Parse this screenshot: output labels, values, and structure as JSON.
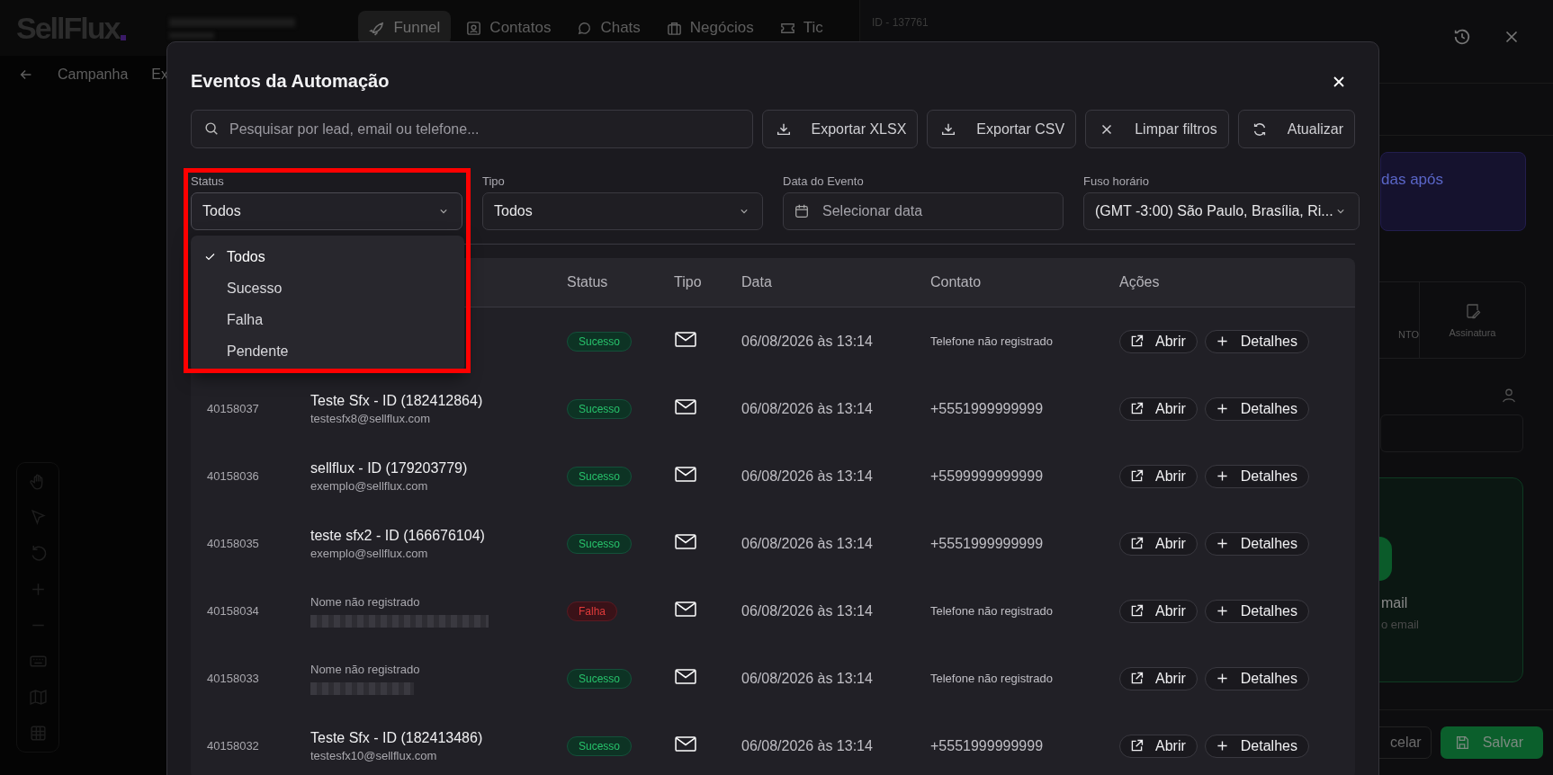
{
  "app": {
    "logo": "SellFlux",
    "nav": [
      {
        "label": "Funnel",
        "selected": true,
        "kind": "rocket"
      },
      {
        "label": "Contatos",
        "selected": false,
        "kind": "contact"
      },
      {
        "label": "Chats",
        "selected": false,
        "kind": "chat"
      },
      {
        "label": "Negócios",
        "selected": false,
        "kind": "briefcase"
      },
      {
        "label": "Tic",
        "selected": false,
        "kind": "ticket"
      }
    ],
    "breadcrumb": [
      "Campanha",
      "Ex"
    ]
  },
  "side_panel": {
    "id_label": "ID - 137761",
    "banner_text": "das após",
    "cards": [
      {
        "label": "NTO",
        "kind": "partial"
      },
      {
        "label": "Assinatura",
        "kind": "signature"
      }
    ],
    "email_card": {
      "title": "mail",
      "subtitle": "o email"
    },
    "buttons": [
      {
        "label": "celar",
        "kind": "secondary"
      },
      {
        "label": "Salvar",
        "kind": "primary"
      }
    ]
  },
  "modal": {
    "title": "Eventos da Automação",
    "search": {
      "placeholder": "Pesquisar por lead, email ou telefone..."
    },
    "actions": [
      {
        "label": "Exportar XLSX",
        "kind": "download"
      },
      {
        "label": "Exportar CSV",
        "kind": "download"
      },
      {
        "label": "Limpar filtros",
        "kind": "clear"
      },
      {
        "label": "Atualizar",
        "kind": "refresh"
      }
    ],
    "filters": [
      {
        "label": "Status",
        "value": "Todos",
        "kind": "select",
        "open": true,
        "highlighted": true
      },
      {
        "label": "Tipo",
        "value": "Todos",
        "kind": "select",
        "open": false
      },
      {
        "label": "Data do Evento",
        "placeholder": "Selecionar data",
        "kind": "date"
      },
      {
        "label": "Fuso horário",
        "value": "(GMT -3:00) São Paulo, Brasília, Ri...",
        "kind": "select",
        "open": false
      }
    ],
    "status_menu": [
      {
        "label": "Todos",
        "selected": true
      },
      {
        "label": "Sucesso",
        "selected": false
      },
      {
        "label": "Falha",
        "selected": false
      },
      {
        "label": "Pendente",
        "selected": false
      }
    ],
    "table": {
      "columns": [
        "Status",
        "Tipo",
        "Data",
        "Contato",
        "Ações"
      ],
      "rows": [
        {
          "status": {
            "label": "Sucesso",
            "kind": "success"
          },
          "date": "06/08/2026 às 13:14",
          "contact": {
            "text": "Telefone não registrado",
            "kind": "missing"
          },
          "actions": [
            "Abrir",
            "Detalhes"
          ]
        },
        {
          "id": "40158037",
          "lead": {
            "name": "Teste Sfx - ID (182412864)",
            "email": "testesfx8@sellflux.com",
            "kind": "named"
          },
          "status": {
            "label": "Sucesso",
            "kind": "success"
          },
          "date": "06/08/2026 às 13:14",
          "contact": {
            "text": "+5551999999999",
            "kind": "phone"
          },
          "actions": [
            "Abrir",
            "Detalhes"
          ]
        },
        {
          "id": "40158036",
          "lead": {
            "name": "sellflux - ID (179203779)",
            "email": "exemplo@sellflux.com",
            "kind": "named"
          },
          "status": {
            "label": "Sucesso",
            "kind": "success"
          },
          "date": "06/08/2026 às 13:14",
          "contact": {
            "text": "+5599999999999",
            "kind": "phone"
          },
          "actions": [
            "Abrir",
            "Detalhes"
          ]
        },
        {
          "id": "40158035",
          "lead": {
            "name": "teste sfx2 - ID (166676104)",
            "email": "exemplo@sellflux.com",
            "kind": "named"
          },
          "status": {
            "label": "Sucesso",
            "kind": "success"
          },
          "date": "06/08/2026 às 13:14",
          "contact": {
            "text": "+5551999999999",
            "kind": "phone"
          },
          "actions": [
            "Abrir",
            "Detalhes"
          ]
        },
        {
          "id": "40158034",
          "lead": {
            "name": "Nome não registrado",
            "email_hidden": true,
            "kind": "missing"
          },
          "status": {
            "label": "Falha",
            "kind": "failure"
          },
          "date": "06/08/2026 às 13:14",
          "contact": {
            "text": "Telefone não registrado",
            "kind": "missing"
          },
          "actions": [
            "Abrir",
            "Detalhes"
          ]
        },
        {
          "id": "40158033",
          "lead": {
            "name": "Nome não registrado",
            "email_hidden": true,
            "kind": "missing"
          },
          "status": {
            "label": "Sucesso",
            "kind": "success"
          },
          "date": "06/08/2026 às 13:14",
          "contact": {
            "text": "Telefone não registrado",
            "kind": "missing"
          },
          "actions": [
            "Abrir",
            "Detalhes"
          ]
        },
        {
          "id": "40158032",
          "lead": {
            "name": "Teste Sfx - ID (182413486)",
            "email": "testesfx10@sellflux.com",
            "kind": "named"
          },
          "status": {
            "label": "Sucesso",
            "kind": "success"
          },
          "date": "06/08/2026 às 13:14",
          "contact": {
            "text": "+5551999999999",
            "kind": "phone"
          },
          "actions": [
            "Abrir",
            "Detalhes"
          ]
        }
      ]
    }
  }
}
